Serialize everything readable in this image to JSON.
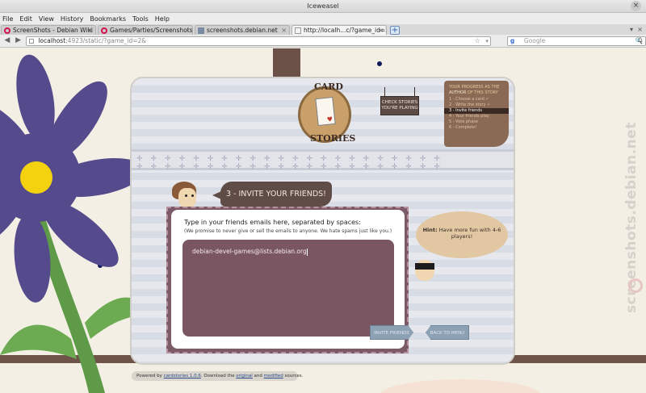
{
  "window": {
    "title": "Iceweasel",
    "close_glyph": "×"
  },
  "menu": [
    "File",
    "Edit",
    "View",
    "History",
    "Bookmarks",
    "Tools",
    "Help"
  ],
  "tabs": [
    {
      "label": "ScreenShots - Debian Wiki",
      "icon_color": "#d0114a"
    },
    {
      "label": "Games/Parties/Screenshots ...",
      "icon_color": "#d0114a"
    },
    {
      "label": "screenshots.debian.net",
      "icon_color": "#7a8aa0"
    },
    {
      "label": "http://localh...c/?game_id=2&",
      "icon_color": "#ffffff"
    }
  ],
  "toolbar": {
    "back_glyph": "◀",
    "forward_glyph": "▶",
    "url_host": "localhost",
    "url_rest": ":4923/static/?game_id=2&",
    "star_glyph": "☆",
    "dropdown_glyph": "▾",
    "search_placeholder": "Google",
    "search_engine_glyph": "g",
    "search_glyph": "🔍",
    "home_glyph": "⌂",
    "newtab_glyph": "+",
    "tablist_glyph": "▾",
    "tab_close_glyph": "×"
  },
  "game": {
    "logo_word1": "CARD",
    "logo_word2": "STORIES",
    "check_stories_label": "CHECK STORIES YOU'RE PLAYING",
    "progress": {
      "heading_pre": "YOUR PROGRESS AS THE",
      "heading_author": "AUTHOR",
      "heading_post": "OF THIS STORY",
      "steps": [
        "1 - Choose a card ✓",
        "2 - Write the story ✓",
        "3 - Invite friends",
        "4 - Your friends play",
        "5 - Vote phase",
        "6 - Complete!"
      ],
      "current_step": 3
    },
    "step_title": "3 - INVITE YOUR FRIENDS!",
    "prompt": "Type in your friends emails here, separated by spaces:",
    "privacy_note": "(We promise to never give or sell the emails to anyone. We hate spams just like you.)",
    "emails_value": "debian-devel-games@lists.debian.org",
    "hint_label": "Hint:",
    "hint_text": "Have more fun with 4-6 players!",
    "invite_button": "INVITE FRIENDS",
    "back_button": "BACK TO MENU",
    "crosses": "✛✛✛✛✛✛✛✛✛✛✛✛✛✛✛✛✛✛✛✛✛✛"
  },
  "footer": {
    "pre": "Powered by",
    "link1": "cardstories 1.0.6",
    "mid1": ". Download the",
    "link2": "original",
    "mid2": "and",
    "link3": "modified",
    "post": "sources."
  },
  "watermark": "screenshots.debian.net",
  "colors": {
    "accent_brown": "#5f4c47",
    "email_box": "#7a5663",
    "flower": "#544a8c"
  }
}
